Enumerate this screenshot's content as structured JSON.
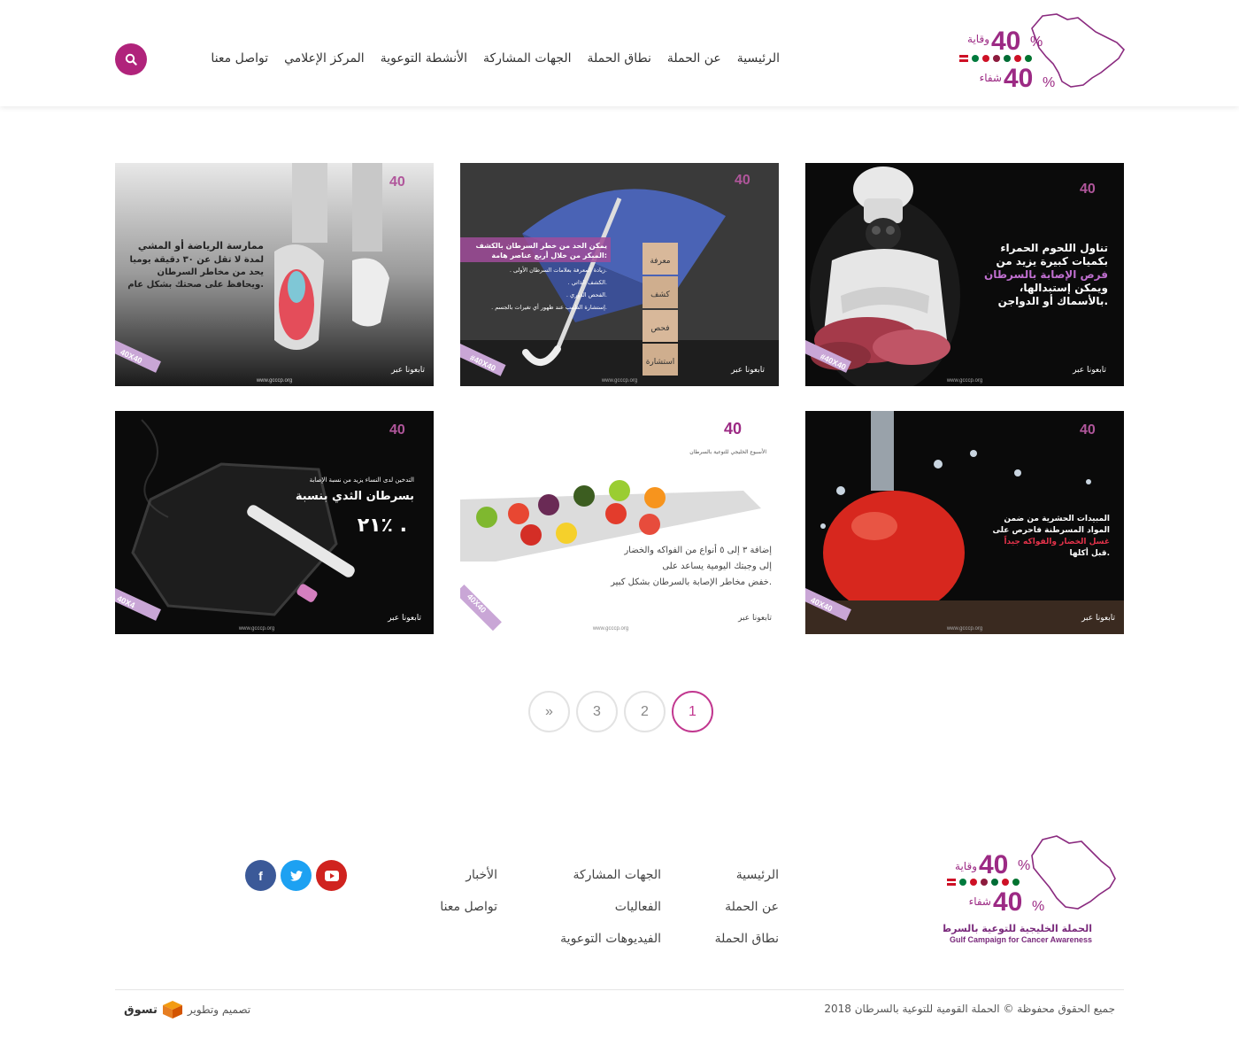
{
  "brand": {
    "logo_number_top": "40",
    "logo_number_bottom": "40",
    "logo_word_top": "وقاية",
    "logo_word_bottom": "شفاء",
    "logo_caption_ar": "الحملة الخليجية للتوعية بالسرطان",
    "logo_caption_en": "Gulf Campaign for Cancer Awareness",
    "accent_color": "#b0237b"
  },
  "nav": {
    "items": [
      {
        "label": "الرئيسية"
      },
      {
        "label": "عن الحملة"
      },
      {
        "label": "نطاق الحملة"
      },
      {
        "label": "الجهات المشاركة"
      },
      {
        "label": "الأنشطة التوعوية"
      },
      {
        "label": "المركز الإعلامي"
      },
      {
        "label": "تواصل معنا"
      }
    ],
    "search_icon": "search-icon"
  },
  "cards": [
    {
      "lines": [
        "تناول اللحوم الحمراء",
        "بكميات كبيرة يزيد من",
        "فرص الإصابة بالسرطان",
        "،ويمكن إستبدالها",
        "بالأسماك أو الدواجن."
      ],
      "follow": "تابعونا عبر",
      "site": "www.gcccp.org",
      "tag": "#40X40"
    },
    {
      "lines": [
        "يمكن الحد من خطر السرطان بالكشف",
        "المبكر من خلال أربع عناصر هامة:",
        ". زيادة المعرفة بعلامات السرطان الأولى.",
        ". الكشف الذاتي.",
        ". الفحص الدوري.",
        ". إستشارة الطبيب عند ظهور أي تغيرات بالجسم."
      ],
      "blocks": [
        "معرفة",
        "كشف",
        "فحص",
        "استشارة"
      ],
      "follow": "تابعونا عبر",
      "site": "www.gcccp.org",
      "tag": "#40X40"
    },
    {
      "lines": [
        "ممارسة الرياضة أو المشي",
        "لمدة لا تقل عن ٣٠ دقيقة يوميا",
        "يحد من مخاطر السرطان",
        "ويحافظ على صحتك بشكل عام."
      ],
      "follow": "تابعونا عبر",
      "site": "www.gcccp.org",
      "tag": "40X40"
    },
    {
      "lines": [
        "المبيدات الحشرية من ضمن",
        "المواد المسرطنة فاحرص على",
        "غسل الخضار والفواكه جيداً",
        "قبل أكلها."
      ],
      "follow": "تابعونا عبر",
      "site": "www.gcccp.org",
      "tag": "40X40"
    },
    {
      "lines": [
        "إضافة ٣ إلى ٥ أنواع من الفواكه والخضار",
        "إلى وجبتك اليومية يساعد على",
        "خفض مخاطر الإصابة بالسرطان بشكل كبير."
      ],
      "follow": "تابعونا عبر",
      "site": "www.gcccp.org",
      "tag": "40X40",
      "sub": "الأسبوع الخليجي للتوعية بالسرطان"
    },
    {
      "lines": [
        "التدخين لدى النساء يزيد من نسبة الإصابة",
        "بسرطان الثدي بنسبة",
        "٢١٪ ."
      ],
      "follow": "تابعونا عبر",
      "site": "www.gcccp.org",
      "tag": "40X4"
    }
  ],
  "pagination": {
    "pages": [
      "1",
      "2",
      "3"
    ],
    "next": "»",
    "active": "1"
  },
  "footer": {
    "col1": [
      "الرئيسية",
      "عن الحملة",
      "نطاق الحملة"
    ],
    "col2": [
      "الجهات المشاركة",
      "الفعاليات",
      "الفيديوهات التوعوية"
    ],
    "col3": [
      "الأخبار",
      "تواصل معنا"
    ],
    "social": [
      {
        "icon": "youtube-icon",
        "glyph": "▶",
        "color": "#d0231f"
      },
      {
        "icon": "twitter-icon",
        "glyph": "t",
        "color": "#1da1f2"
      },
      {
        "icon": "facebook-icon",
        "glyph": "f",
        "color": "#3b5998"
      }
    ],
    "copyright": "جميع الحقوق محفوظة © الحملة القومية للتوعية بالسرطان 2018",
    "credit_text": "تصميم وتطوير",
    "credit_brand": "تسوق"
  }
}
